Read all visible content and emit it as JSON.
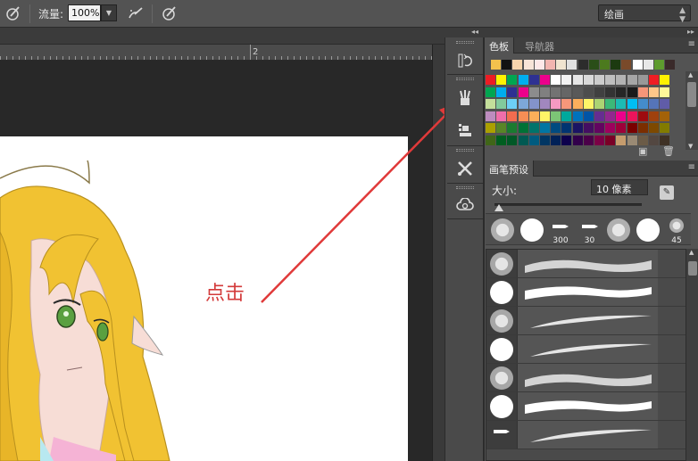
{
  "options_bar": {
    "flow_label": "流量:",
    "flow_value": "100%",
    "mode_value": "绘画"
  },
  "ruler": {
    "mark": "2"
  },
  "annotation": {
    "text": "点击"
  },
  "swatches_panel": {
    "tabs": [
      {
        "label": "色板",
        "active": true
      },
      {
        "label": "导航器",
        "active": false
      }
    ],
    "recent_colors": [
      "#f3c24d",
      "#121212",
      "#f7d5ae",
      "#f7e4d8",
      "#fde8e8",
      "#f2b5b0",
      "#f0e4d0",
      "#e0e0e0",
      "#2c2c2c",
      "#2a4e18",
      "#4c7a1e",
      "#1c3a10",
      "#7a4a2a",
      "#ffffff",
      "#e8e8e8",
      "#5e9b2e",
      "#3a2a2a"
    ],
    "grid_colors": [
      [
        "#ed1c24",
        "#fff200",
        "#00a651",
        "#00aeef",
        "#2e3192",
        "#ec008c",
        "#ffffff",
        "#f2f2f2",
        "#e6e6e6",
        "#d9d9d9",
        "#cccccc",
        "#bfbfbf",
        "#b3b3b3",
        "#a6a6a6",
        "#999999",
        "#ee1d24",
        "#fff100"
      ],
      [
        "#00a650",
        "#00adef",
        "#2e3092",
        "#ec008b",
        "#8c8c8c",
        "#808080",
        "#737373",
        "#666666",
        "#595959",
        "#4d4d4d",
        "#404040",
        "#333333",
        "#262626",
        "#1a1a1a",
        "#f69679",
        "#fdc689",
        "#fff799"
      ],
      [
        "#c4df9b",
        "#82ca9c",
        "#6dcff6",
        "#7da7d9",
        "#8393ca",
        "#a187be",
        "#f49ac2",
        "#f7977a",
        "#fbaf5c",
        "#fff568",
        "#acd373",
        "#3cb878",
        "#1cbbb4",
        "#00bff3",
        "#448ccb",
        "#5574b9",
        "#605ca8"
      ],
      [
        "#bd8cbf",
        "#f06eaa",
        "#f26c4f",
        "#f68e55",
        "#fbaf5a",
        "#fff467",
        "#7cc576",
        "#00a99d",
        "#0072bc",
        "#0054a6",
        "#662d91",
        "#92278f",
        "#ec008c",
        "#ed145b",
        "#9e0b0f",
        "#a0410d",
        "#a36209"
      ],
      [
        "#aba000",
        "#598527",
        "#1a7b30",
        "#007236",
        "#00746b",
        "#0076a3",
        "#004b80",
        "#003471",
        "#1b1464",
        "#440e62",
        "#630460",
        "#9e005d",
        "#9e0039",
        "#790000",
        "#7b2e00",
        "#7d4900",
        "#827b00"
      ],
      [
        "#406618",
        "#005e20",
        "#005826",
        "#005952",
        "#005b7f",
        "#003663",
        "#002157",
        "#0d004c",
        "#32004b",
        "#4b0049",
        "#7b0046",
        "#7a0026",
        "#c69c6d",
        "#9a8a74",
        "#6b5b47",
        "#534741",
        "#3f3125"
      ]
    ]
  },
  "brush_panel": {
    "tabs": [
      {
        "label": "画笔预设",
        "active": true
      }
    ],
    "size_label": "大小:",
    "size_value": "10 像素",
    "size_fraction": 0.02,
    "preset_tiles": [
      {
        "kind": "soft",
        "label": ""
      },
      {
        "kind": "hard",
        "label": ""
      },
      {
        "kind": "pen",
        "label": "300"
      },
      {
        "kind": "pen",
        "label": "30"
      },
      {
        "kind": "soft",
        "label": ""
      },
      {
        "kind": "hard",
        "label": ""
      },
      {
        "kind": "small-soft",
        "label": "45"
      }
    ],
    "brush_rows": [
      {
        "thumb": "soft",
        "stroke": "soft"
      },
      {
        "thumb": "hard",
        "stroke": "hard"
      },
      {
        "thumb": "soft",
        "stroke": "taper"
      },
      {
        "thumb": "hard",
        "stroke": "taper"
      },
      {
        "thumb": "soft",
        "stroke": "soft"
      },
      {
        "thumb": "hard",
        "stroke": "hard"
      },
      {
        "thumb": "pen",
        "stroke": "taper"
      }
    ]
  }
}
